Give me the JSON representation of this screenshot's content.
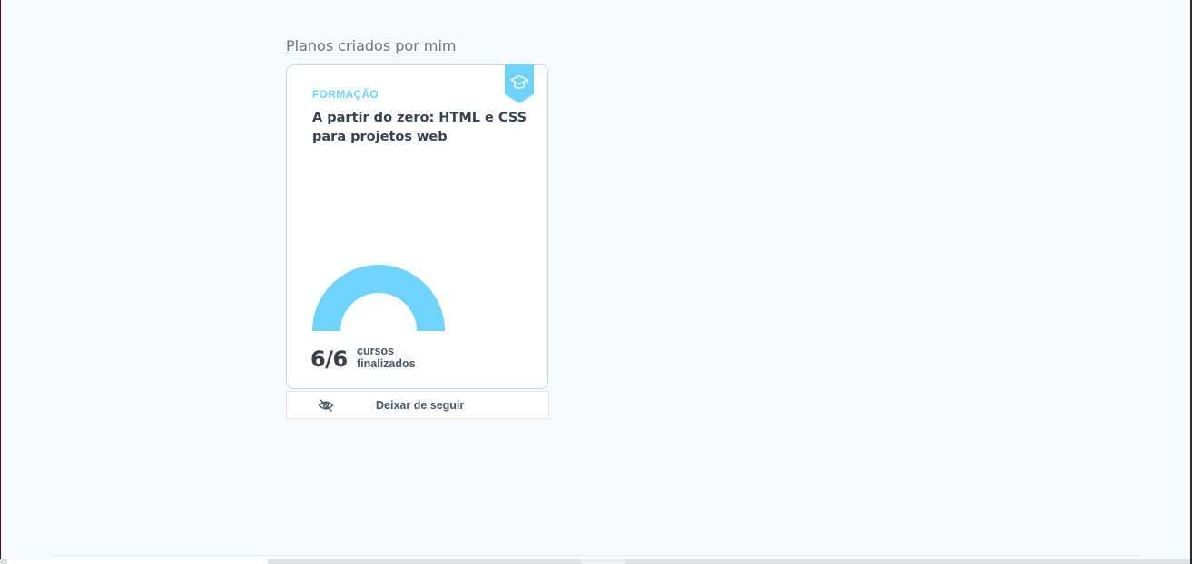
{
  "section": {
    "title": "Planos criados por mim"
  },
  "card": {
    "category": "FORMAÇÃO",
    "title": "A partir do zero: HTML e CSS para projetos web",
    "ribbon_icon": "graduation-cap-icon",
    "accent_color": "#6fd3fb",
    "progress": {
      "completed": 6,
      "total": 6,
      "count_text": "6/6",
      "label": "cursos finalizados"
    }
  },
  "actions": {
    "unfollow_label": "Deixar de seguir",
    "unfollow_icon": "eye-off-icon"
  }
}
